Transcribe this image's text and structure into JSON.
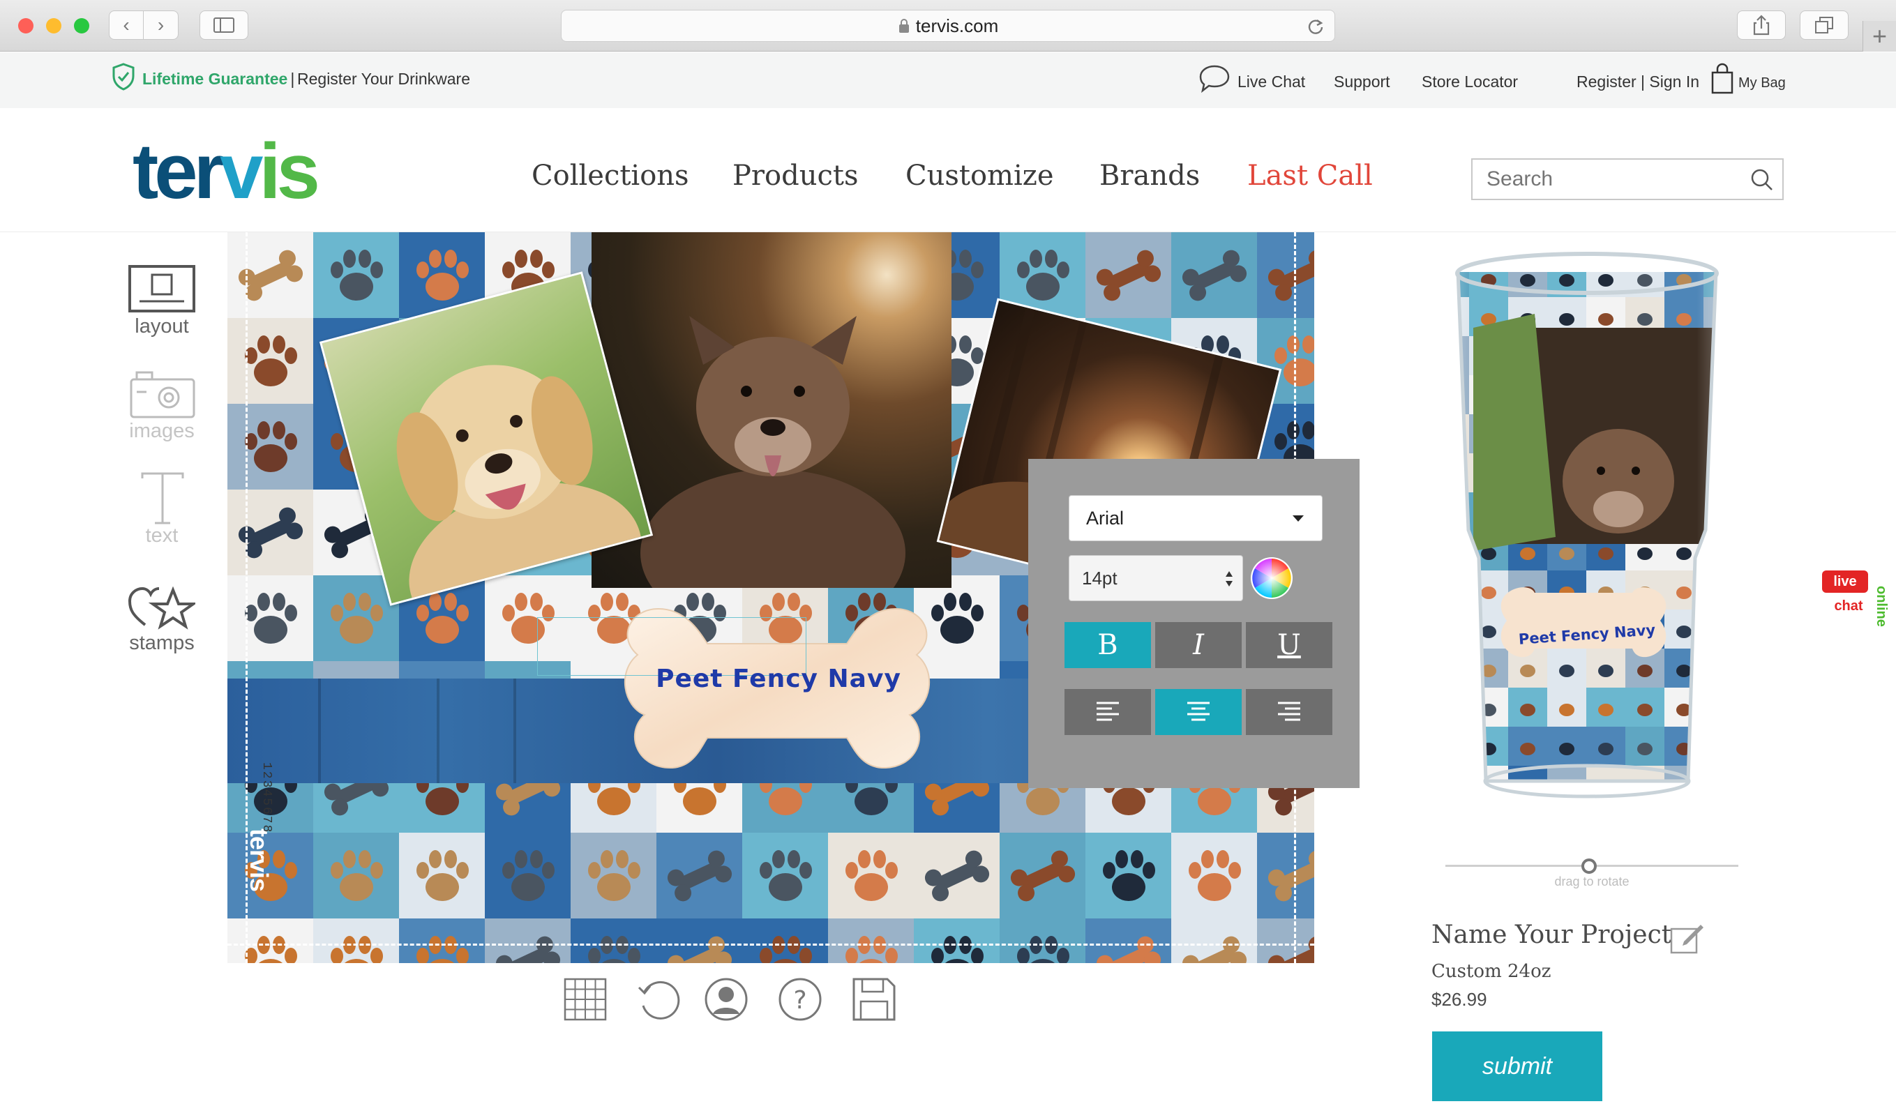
{
  "browser": {
    "url": "tervis.com"
  },
  "utility": {
    "guarantee": "Lifetime Guarantee",
    "separator": " | ",
    "register_drinkware": "Register Your Drinkware",
    "live_chat": "Live Chat",
    "support": "Support",
    "store_locator": "Store Locator",
    "register_sign_in": "Register | Sign In",
    "my_bag": "My Bag"
  },
  "header": {
    "logo": "tervis",
    "nav": [
      "Collections",
      "Products",
      "Customize",
      "Brands",
      "Last Call"
    ],
    "search_placeholder": "Search"
  },
  "tools": [
    "layout",
    "images",
    "text",
    "stamps"
  ],
  "canvas": {
    "name_text": "Peet Fency Navy",
    "barcode_text": "12345678",
    "brand_mark": "tervis"
  },
  "text_panel": {
    "font": "Arial",
    "size": "14pt",
    "bold": "B",
    "italic": "I",
    "underline": "U",
    "active_align": "center"
  },
  "preview": {
    "tumbler_text": "Peet Fency Navy",
    "rotate_hint": "drag to rotate",
    "rotate_position": 0.5,
    "project_title": "Name Your Project",
    "product": "Custom 24oz",
    "price": "$26.99",
    "submit": "submit",
    "live_chat_badge": "live",
    "live_chat_sub": "chat",
    "online": "online"
  },
  "colors": {
    "brand_teal": "#19a8ba",
    "guarantee_green": "#2fa66a",
    "last_call_red": "#e1463a",
    "name_blue": "#1f3aa8"
  }
}
